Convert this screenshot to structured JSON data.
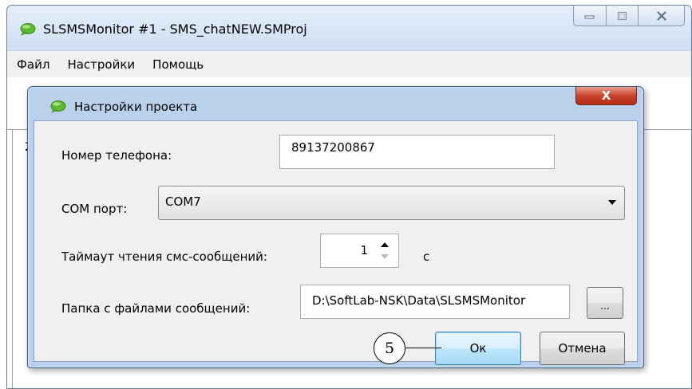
{
  "window": {
    "title": "SLSMSMonitor #1 - SMS_chatNEW.SMProj",
    "icon": "chat-bubble-icon",
    "caption_buttons": [
      "minimize-icon",
      "maximize-icon",
      "close-icon"
    ]
  },
  "menu": {
    "items": [
      {
        "label": "Файл"
      },
      {
        "label": "Настройки"
      },
      {
        "label": "Помощь"
      }
    ]
  },
  "background": {
    "peek_text": "2"
  },
  "dialog": {
    "title": "Настройки проекта",
    "icon": "chat-bubble-icon",
    "close_label": "X",
    "phone": {
      "label": "Номер телефона:",
      "value": "89137200867"
    },
    "com_port": {
      "label": "COM порт:",
      "selected": "COM7"
    },
    "timeout": {
      "label": "Таймаут чтения смс-сообщений:",
      "value": "1",
      "unit": "с"
    },
    "folder": {
      "label": "Папка с файлами сообщений:",
      "value": "D:\\SoftLab-NSK\\Data\\SLSMSMonitor",
      "browse_label": "..."
    },
    "ok_label": "Ок",
    "cancel_label": "Отмена"
  },
  "callout": {
    "number": "5"
  },
  "colors": {
    "title_bar": "#d5e3f3",
    "dialog_frame": "#b9d1ea",
    "close_red": "#c8442c",
    "icon_green": "#5cb82e"
  }
}
